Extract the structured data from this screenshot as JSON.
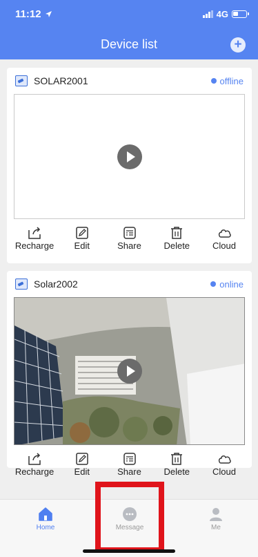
{
  "status_bar": {
    "time": "11:12",
    "network": "4G"
  },
  "header": {
    "title": "Device list",
    "add_icon": "plus-circle-icon"
  },
  "devices": [
    {
      "name": "SOLAR2001",
      "status": "offline",
      "feed": "blank"
    },
    {
      "name": "Solar2002",
      "status": "online",
      "feed": "live"
    }
  ],
  "actions": [
    {
      "label": "Recharge",
      "icon": "recharge-icon"
    },
    {
      "label": "Edit",
      "icon": "edit-icon"
    },
    {
      "label": "Share",
      "icon": "share-icon"
    },
    {
      "label": "Delete",
      "icon": "delete-icon"
    },
    {
      "label": "Cloud",
      "icon": "cloud-icon"
    }
  ],
  "tabs": [
    {
      "label": "Home",
      "icon": "home-icon",
      "active": true
    },
    {
      "label": "Message",
      "icon": "message-icon",
      "active": false
    },
    {
      "label": "Me",
      "icon": "person-icon",
      "active": false
    }
  ],
  "colors": {
    "accent": "#5684f1",
    "highlight": "#e0141b"
  }
}
